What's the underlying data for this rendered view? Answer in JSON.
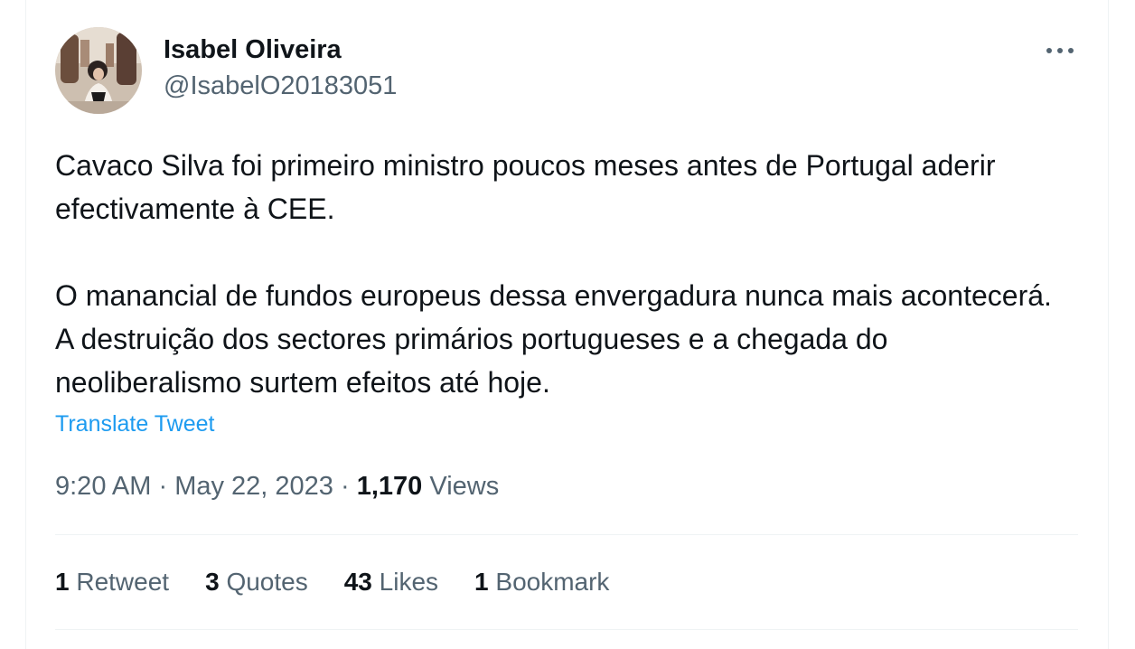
{
  "author": {
    "display_name": "Isabel Oliveira",
    "handle": "@IsabelO20183051"
  },
  "tweet": {
    "paragraph_1": "Cavaco Silva foi primeiro ministro poucos meses antes de Portugal aderir efectivamente à CEE.",
    "paragraph_2": "O manancial de fundos europeus dessa envergadura nunca mais acontecerá. A destruição dos sectores primários portugueses e a chegada do neoliberalismo surtem efeitos até hoje.",
    "translate_label": "Translate Tweet"
  },
  "meta": {
    "time": "9:20 AM",
    "date": "May 22, 2023",
    "separator": "·",
    "views_count": "1,170",
    "views_label": "Views"
  },
  "stats": [
    {
      "count": "1",
      "label": "Retweet"
    },
    {
      "count": "3",
      "label": "Quotes"
    },
    {
      "count": "43",
      "label": "Likes"
    },
    {
      "count": "1",
      "label": "Bookmark"
    }
  ],
  "icons": {
    "more": "more-horizontal-icon",
    "avatar": "profile-photo"
  },
  "colors": {
    "text_primary": "#0f1419",
    "text_secondary": "#536471",
    "link": "#1d9bf0",
    "divider": "#eff3f4"
  }
}
